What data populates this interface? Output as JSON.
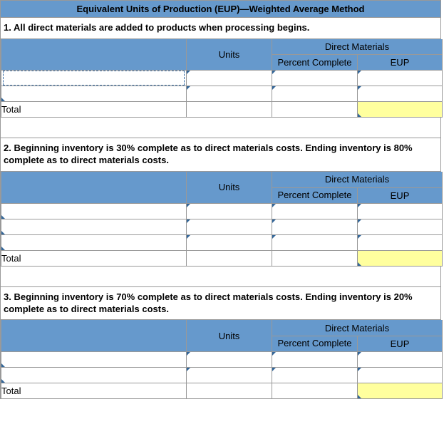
{
  "title": "Equivalent Units of Production (EUP)—Weighted Average Method",
  "headers": {
    "units": "Units",
    "dm": "Direct Materials",
    "pct": "Percent Complete",
    "eup": "EUP"
  },
  "total_label": "Total",
  "sections": [
    {
      "instruction": "1. All direct materials are added to products when processing begins.",
      "rows": [
        {
          "desc": "",
          "units": "",
          "pct": "",
          "eup": "",
          "dropdown": true
        },
        {
          "desc": "",
          "units": "",
          "pct": "",
          "eup": ""
        }
      ],
      "total": {
        "units": "",
        "eup": ""
      }
    },
    {
      "instruction": "2. Beginning inventory is 30% complete as to direct materials costs. Ending inventory is 80% complete as to direct materials costs.",
      "rows": [
        {
          "desc": "",
          "units": "",
          "pct": "",
          "eup": ""
        },
        {
          "desc": "",
          "units": "",
          "pct": "",
          "eup": ""
        },
        {
          "desc": "",
          "units": "",
          "pct": "",
          "eup": ""
        }
      ],
      "total": {
        "units": "",
        "eup": ""
      }
    },
    {
      "instruction": "3. Beginning inventory is 70% complete as to direct materials costs. Ending inventory is 20% complete as to direct materials costs.",
      "rows": [
        {
          "desc": "",
          "units": "",
          "pct": "",
          "eup": ""
        },
        {
          "desc": "",
          "units": "",
          "pct": "",
          "eup": ""
        }
      ],
      "total": {
        "units": "",
        "eup": ""
      }
    }
  ]
}
